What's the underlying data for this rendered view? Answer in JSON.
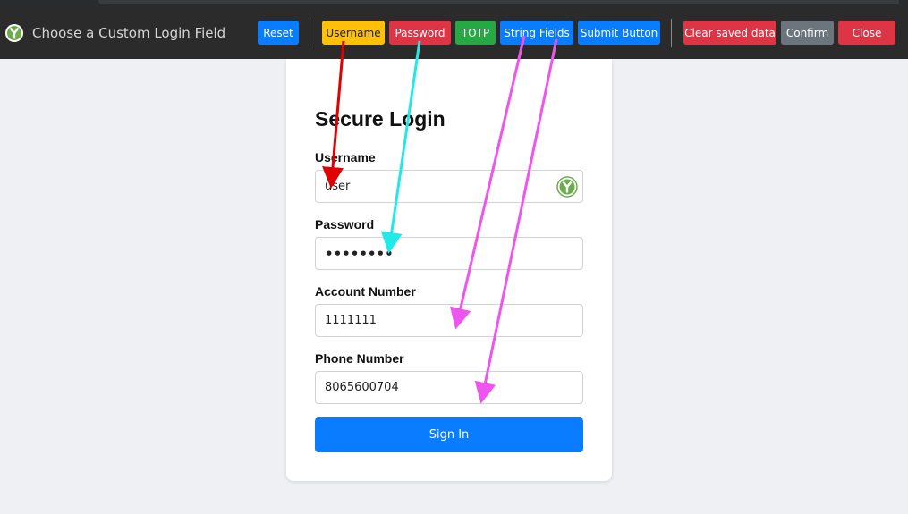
{
  "toolbar": {
    "title": "Choose a Custom Login Field",
    "buttons": {
      "reset": "Reset",
      "username": "Username",
      "password": "Password",
      "totp": "TOTP",
      "string_fields": "String Fields",
      "submit_button": "Submit Button",
      "clear_saved": "Clear saved data",
      "confirm": "Confirm",
      "close": "Close"
    },
    "colors": {
      "blue": "#0a7cff",
      "yellow": "#ffc107",
      "red": "#dc3545",
      "green": "#28a745",
      "gray": "#6c757d"
    }
  },
  "form": {
    "title": "Secure Login",
    "fields": {
      "username": {
        "label": "Username",
        "value": "user"
      },
      "password": {
        "label": "Password",
        "value": "••••••••"
      },
      "account": {
        "label": "Account Number",
        "value": "1111111"
      },
      "phone": {
        "label": "Phone Number",
        "value": "8065600704"
      }
    },
    "submit_label": "Sign In"
  },
  "annotations": {
    "arrow_colors": {
      "username": "#e00000",
      "password": "#22e8e8",
      "string_fields": "#ee55ee"
    }
  }
}
